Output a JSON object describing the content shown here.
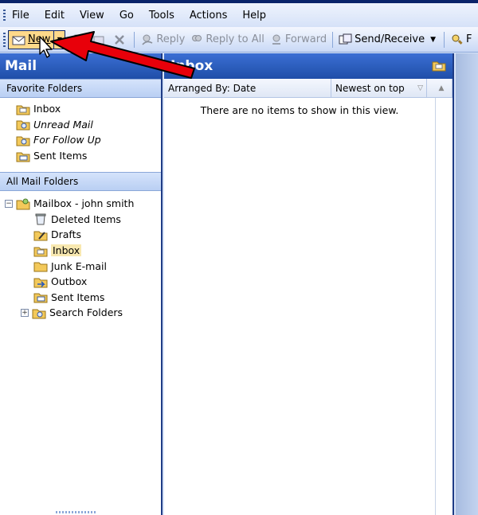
{
  "menu": {
    "items": [
      "File",
      "Edit",
      "View",
      "Go",
      "Tools",
      "Actions",
      "Help"
    ]
  },
  "toolbar": {
    "new_label": "New",
    "reply_label": "Reply",
    "reply_all_label": "Reply to All",
    "forward_label": "Forward",
    "send_receive_label": "Send/Receive",
    "find_label": "F"
  },
  "nav": {
    "title": "Mail",
    "favorites_header": "Favorite Folders",
    "favorites": [
      {
        "label": "Inbox",
        "icon": "inbox-folder-icon"
      },
      {
        "label": "Unread Mail",
        "icon": "search-folder-icon"
      },
      {
        "label": "For Follow Up",
        "icon": "search-folder-icon"
      },
      {
        "label": "Sent Items",
        "icon": "sent-items-icon"
      }
    ],
    "all_header": "All Mail Folders",
    "mailbox_label": "Mailbox - john smith",
    "folders": [
      {
        "label": "Deleted Items",
        "icon": "deleted-items-icon"
      },
      {
        "label": "Drafts",
        "icon": "drafts-icon"
      },
      {
        "label": "Inbox",
        "icon": "inbox-folder-icon"
      },
      {
        "label": "Junk E-mail",
        "icon": "junk-folder-icon"
      },
      {
        "label": "Outbox",
        "icon": "outbox-icon"
      },
      {
        "label": "Sent Items",
        "icon": "sent-items-icon"
      },
      {
        "label": "Search Folders",
        "icon": "search-folder-icon"
      }
    ]
  },
  "main": {
    "title": "Inbox",
    "arranged_by": "Arranged By: Date",
    "sort_order": "Newest on top",
    "empty_message": "There are no items to show in this view."
  },
  "colors": {
    "header_blue": "#1f4ea8",
    "highlight": "#ffd98a",
    "arrow_red": "#e8000a"
  }
}
